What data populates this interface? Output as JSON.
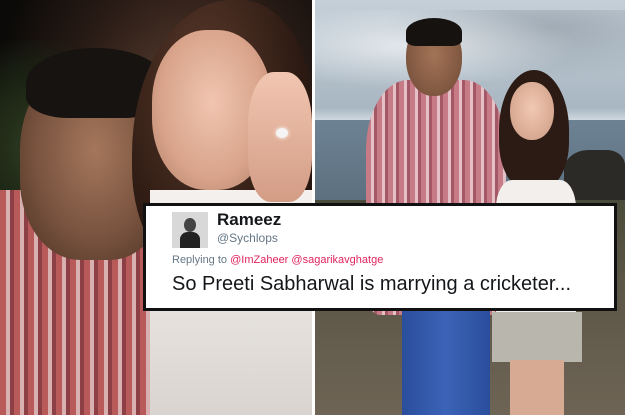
{
  "tweet": {
    "display_name": "Rameez",
    "handle": "@Sychlops",
    "replying_to_label": "Replying to",
    "mentions": [
      "@ImZaheer",
      "@sagarikavghatge"
    ],
    "text": "So Preeti Sabharwal is marrying a cricketer..."
  },
  "colors": {
    "mention": "#e0245e",
    "secondary_text": "#657786",
    "primary_text": "#14171a"
  },
  "icons": {
    "avatar": "user-avatar"
  }
}
